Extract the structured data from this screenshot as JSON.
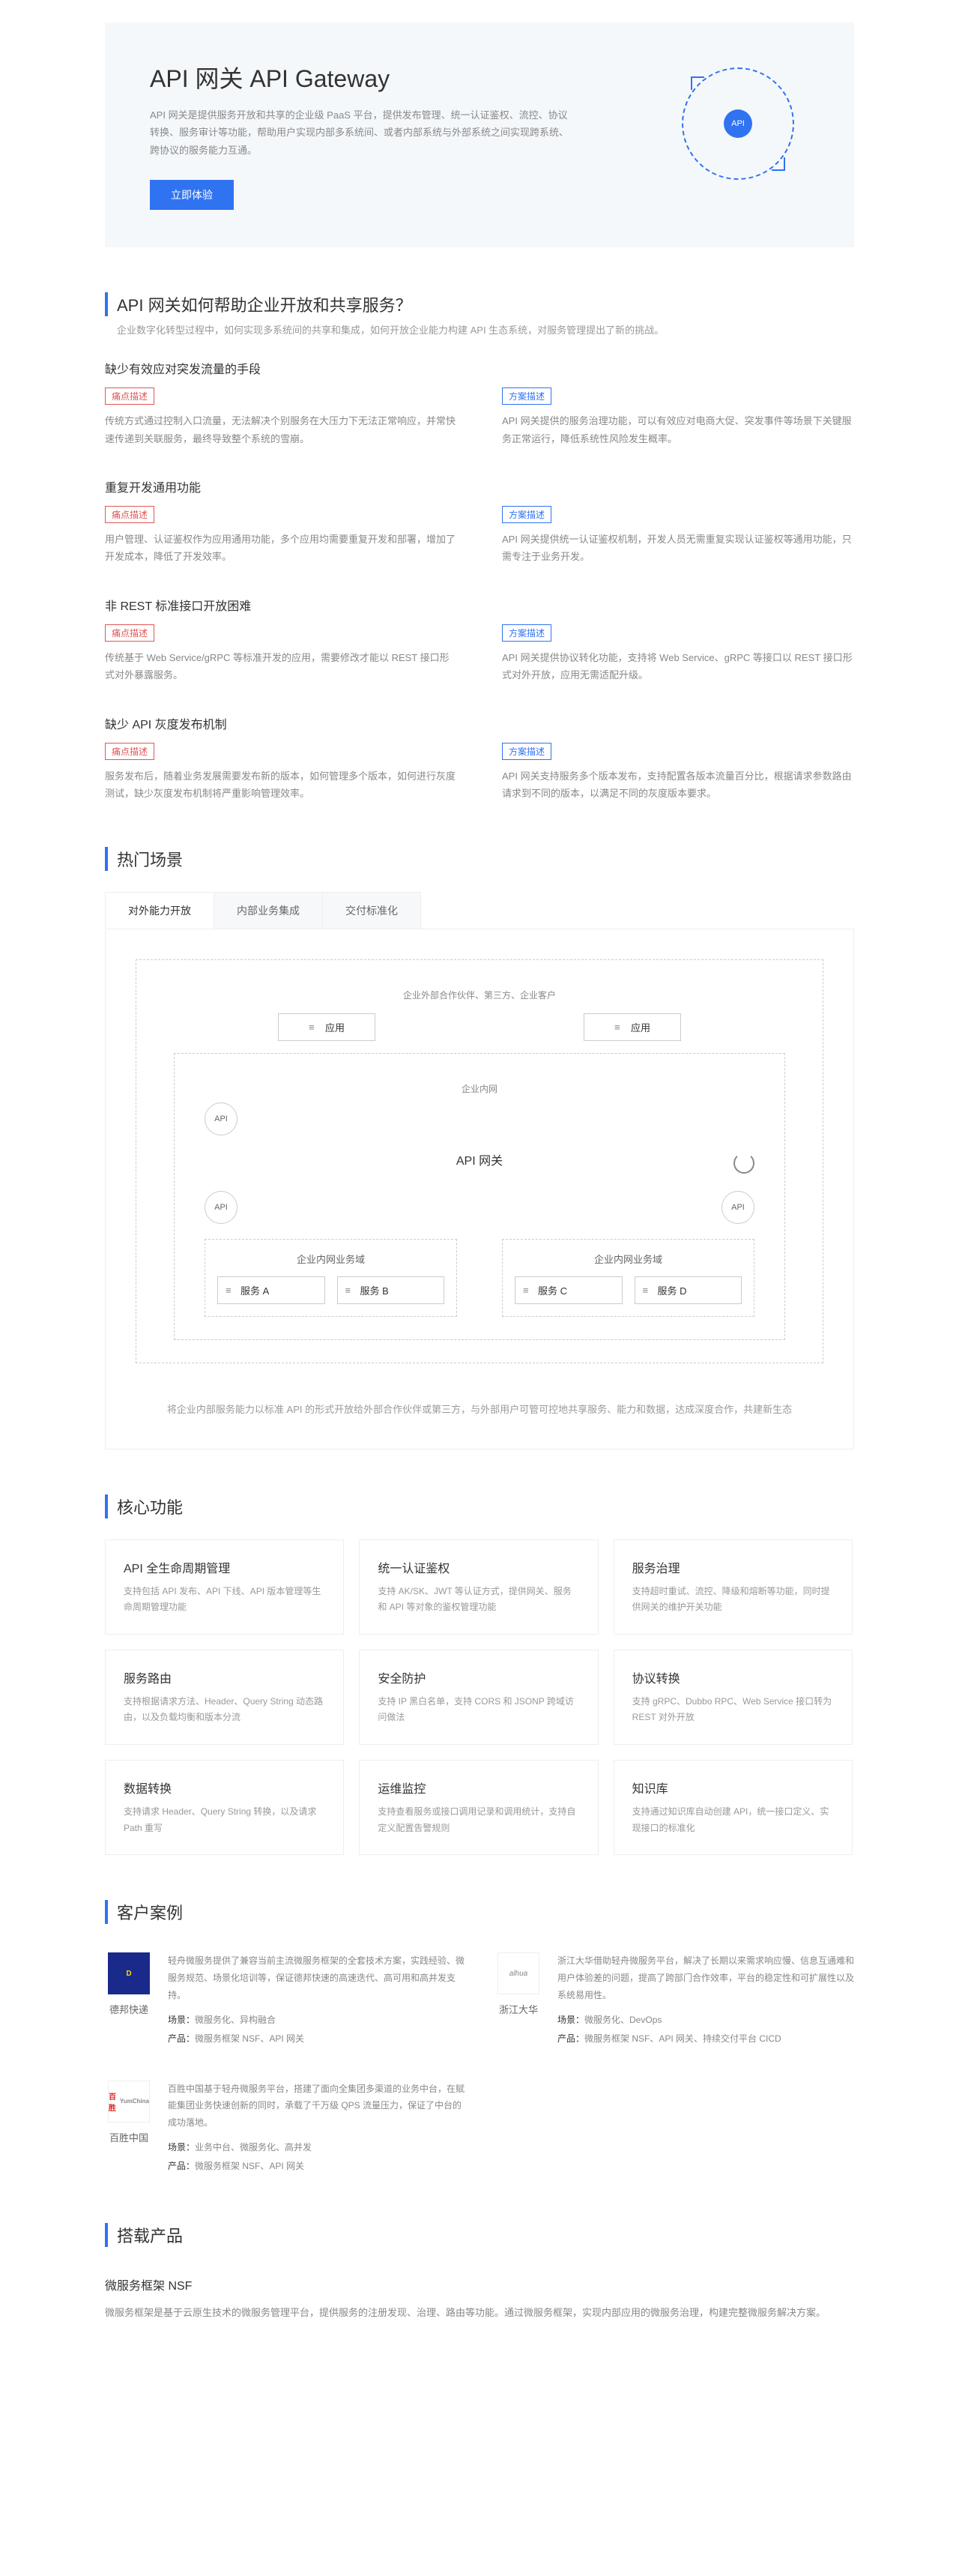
{
  "hero": {
    "title": "API 网关 API Gateway",
    "desc": "API 网关是提供服务开放和共享的企业级 PaaS 平台，提供发布管理、统一认证鉴权、流控、协议转换、服务审计等功能，帮助用户实现内部多系统间、或者内部系统与外部系统之间实现跨系统、跨协议的服务能力互通。",
    "btn": "立即体验",
    "badge": "API"
  },
  "help": {
    "title": "API 网关如何帮助企业开放和共享服务？",
    "sub": "企业数字化转型过程中，如何实现多系统间的共享和集成，如何开放企业能力构建 API 生态系统，对服务管理提出了新的挑战。",
    "tags": {
      "pain": "痛点描述",
      "solution": "方案描述"
    },
    "items": [
      {
        "title": "缺少有效应对突发流量的手段",
        "pain": "传统方式通过控制入口流量，无法解决个别服务在大压力下无法正常响应，并常快速传递到关联服务，最终导致整个系统的雪崩。",
        "solution": "API 网关提供的服务治理功能，可以有效应对电商大促、突发事件等场景下关键服务正常运行，降低系统性风险发生概率。"
      },
      {
        "title": "重复开发通用功能",
        "pain": "用户管理、认证鉴权作为应用通用功能，多个应用均需要重复开发和部署，增加了开发成本，降低了开发效率。",
        "solution": "API 网关提供统一认证鉴权机制，开发人员无需重复实现认证鉴权等通用功能，只需专注于业务开发。"
      },
      {
        "title": "非 REST 标准接口开放困难",
        "pain": "传统基于 Web Service/gRPC 等标准开发的应用，需要修改才能以 REST 接口形式对外暴露服务。",
        "solution": "API 网关提供协议转化功能，支持将 Web Service、gRPC 等接口以 REST 接口形式对外开放，应用无需适配升级。"
      },
      {
        "title": "缺少 API 灰度发布机制",
        "pain": "服务发布后，随着业务发展需要发布新的版本，如何管理多个版本，如何进行灰度测试，缺少灰度发布机制将严重影响管理效率。",
        "solution": "API 网关支持服务多个版本发布，支持配置各版本流量百分比，根据请求参数路由请求到不同的版本，以满足不同的灰度版本要求。"
      }
    ]
  },
  "scenes": {
    "title": "热门场景",
    "tabs": [
      "对外能力开放",
      "内部业务集成",
      "交付标准化"
    ],
    "diag": {
      "external": "企业外部合作伙伴、第三方、企业客户",
      "app": "应用",
      "intranet": "企业内网",
      "gateway": "API 网关",
      "node": "API",
      "domain": "企业内网业务域",
      "svc": [
        "服务 A",
        "服务 B",
        "服务 C",
        "服务 D"
      ]
    },
    "desc": "将企业内部服务能力以标准 API 的形式开放给外部合作伙伴或第三方，与外部用户可管可控地共享服务、能力和数据，达成深度合作，共建新生态"
  },
  "features": {
    "title": "核心功能",
    "items": [
      {
        "t": "API 全生命周期管理",
        "d": "支持包括 API 发布、API 下线、API 版本管理等生命周期管理功能"
      },
      {
        "t": "统一认证鉴权",
        "d": "支持 AK/SK、JWT 等认证方式，提供网关、服务和 API 等对象的鉴权管理功能"
      },
      {
        "t": "服务治理",
        "d": "支持超时重试、流控、降级和熔断等功能，同时提供网关的维护开关功能"
      },
      {
        "t": "服务路由",
        "d": "支持根据请求方法、Header、Query String 动态路由，以及负载均衡和版本分流"
      },
      {
        "t": "安全防护",
        "d": "支持 IP 黑白名单，支持 CORS 和 JSONP 跨域访问做法"
      },
      {
        "t": "协议转换",
        "d": "支持 gRPC、Dubbo RPC、Web Service 接口转为 REST 对外开放"
      },
      {
        "t": "数据转换",
        "d": "支持请求 Header、Query String 转换，以及请求 Path 重写"
      },
      {
        "t": "运维监控",
        "d": "支持查看服务或接口调用记录和调用统计，支持自定义配置告警规则"
      },
      {
        "t": "知识库",
        "d": "支持通过知识库自动创建 API，统一接口定义、实现接口的标准化"
      }
    ]
  },
  "cases": {
    "title": "客户案例",
    "scene_k": "场景：",
    "product_k": "产品：",
    "items": [
      {
        "name": "德邦快递",
        "desc": "轻舟微服务提供了兼容当前主流微服务框架的全套技术方案，实践经验、微服务规范、场景化培训等，保证德邦快速的高速迭代、高可用和高并发支持。",
        "scene": "微服务化、异构融合",
        "product": "微服务框架 NSF、API 网关"
      },
      {
        "name": "浙江大华",
        "desc": "浙江大华借助轻舟微服务平台，解决了长期以来需求响应慢、信息互通难和用户体验差的问题，提高了跨部门合作效率，平台的稳定性和可扩展性以及系统易用性。",
        "scene": "微服务化、DevOps",
        "product": "微服务框架 NSF、API 网关、持续交付平台 CICD"
      },
      {
        "name": "百胜中国",
        "desc": "百胜中国基于轻舟微服务平台，搭建了面向全集团多渠道的业务中台，在赋能集团业务快速创新的同时，承载了千万级 QPS 流量压力，保证了中台的成功落地。",
        "scene": "业务中台、微服务化、高并发",
        "product": "微服务框架 NSF、API 网关"
      }
    ]
  },
  "bundle": {
    "title": "搭载产品",
    "item_title": "微服务框架 NSF",
    "item_desc": "微服务框架是基于云原生技术的微服务管理平台，提供服务的注册发现、治理、路由等功能。通过微服务框架，实现内部应用的微服务治理，构建完整微服务解决方案。"
  }
}
